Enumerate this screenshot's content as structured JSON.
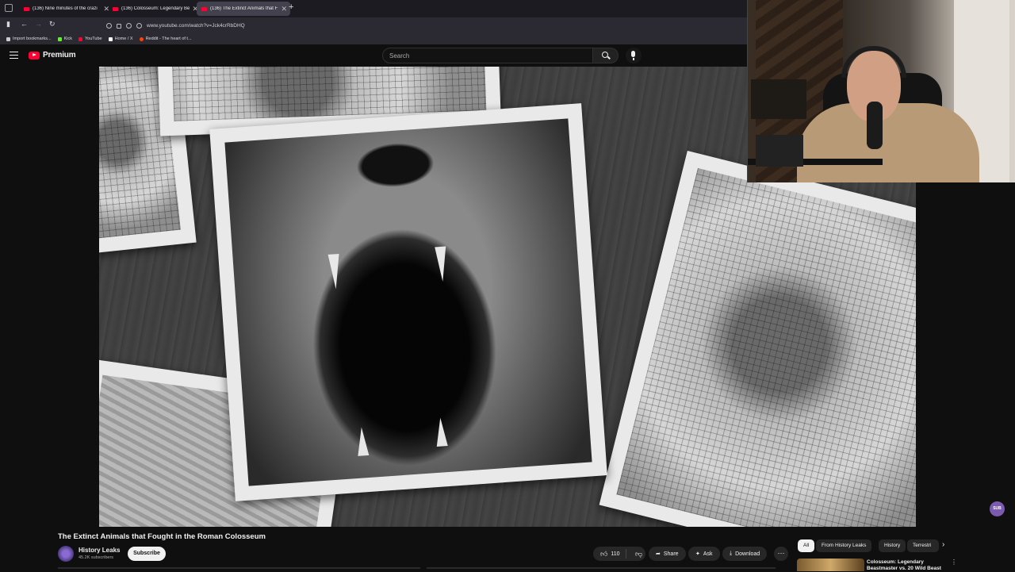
{
  "browser": {
    "tabs": [
      {
        "title": "(136) Nine minutes of the crazi"
      },
      {
        "title": "(136) Colosseum: Legendary Be"
      },
      {
        "title": "(136) The Extinct Animals that F"
      }
    ],
    "url": "www.youtube.com/watch?v=Jck4crRbDHQ",
    "bookmarks": [
      {
        "label": "Import bookmarks...",
        "color": "#cccccc"
      },
      {
        "label": "Kick",
        "color": "#53fc18"
      },
      {
        "label": "YouTube",
        "color": "#ff0033"
      },
      {
        "label": "Home / X",
        "color": "#ffffff"
      },
      {
        "label": "Reddit - The heart of t...",
        "color": "#ff4500"
      }
    ]
  },
  "masthead": {
    "brand": "Premium",
    "search_placeholder": "Search"
  },
  "video": {
    "title": "The Extinct Animals that Fought in the Roman Colosseum",
    "channel": "History Leaks",
    "subscribers": "45.2K subscribers",
    "subscribe_label": "Subscribe",
    "likes": "110",
    "share_label": "Share",
    "ask_label": "Ask",
    "download_label": "Download"
  },
  "chips": [
    "All",
    "From History Leaks",
    "History",
    "Terrestri"
  ],
  "suggestion": {
    "title": "Colosseum: Legendary Beastmaster vs. 20 Wild Beast"
  },
  "overlay_badge": "SUB"
}
